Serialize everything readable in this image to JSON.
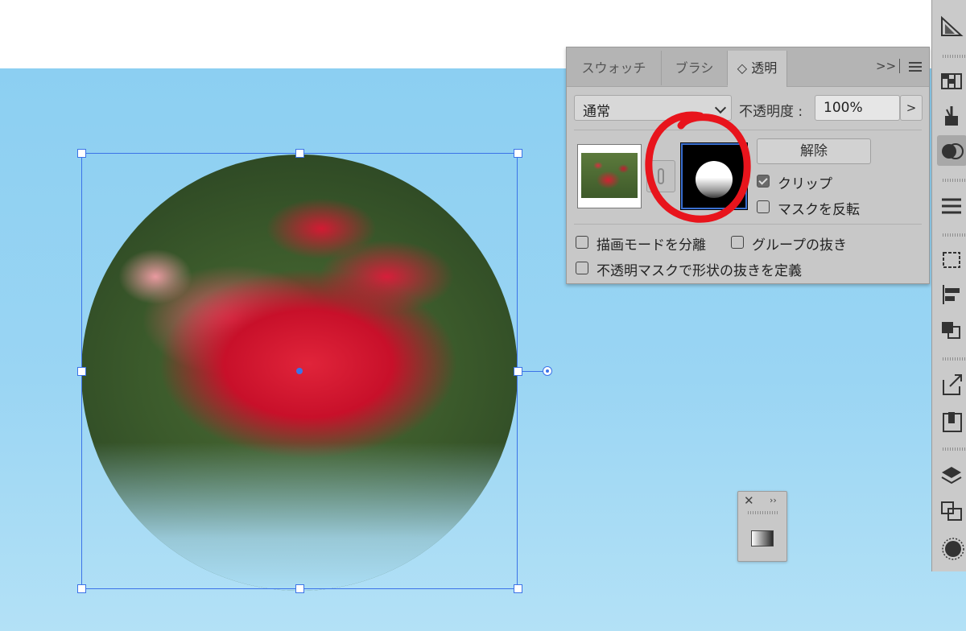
{
  "panel": {
    "tabs": [
      {
        "label": "スウォッチ"
      },
      {
        "label": "ブラシ"
      },
      {
        "label": "◇ 透明"
      }
    ],
    "more_label": ">>",
    "blend_mode": "通常",
    "opacity_label": "不透明度 :",
    "opacity_value": "100%",
    "opacity_arrow": ">",
    "release_label": "解除",
    "clip": {
      "label": "クリップ",
      "checked": true
    },
    "invert_mask": {
      "label": "マスクを反転",
      "checked": false
    },
    "isolate_blending": {
      "label": "描画モードを分離",
      "checked": false
    },
    "knockout_group": {
      "label": "グループの抜き",
      "checked": false
    },
    "opacity_mask_knockout": {
      "label": "不透明マスクで形状の抜きを定義",
      "checked": false
    }
  },
  "mini_panel": {
    "close_label": "✕",
    "more_label": "››"
  },
  "colors": {
    "selection": "#3b73e8",
    "annotation": "#e8141c",
    "canvas": "#8ccff2"
  },
  "icons": {
    "toolstrip": [
      "gradient-icon",
      "swatch-libraries-icon",
      "brush-icon",
      "transparency-icon",
      "stroke-icon",
      "transform-icon",
      "align-icon",
      "pathfinder-icon",
      "export-icon",
      "libraries-icon",
      "layers-icon",
      "artboards-icon",
      "appearance-icon"
    ]
  }
}
